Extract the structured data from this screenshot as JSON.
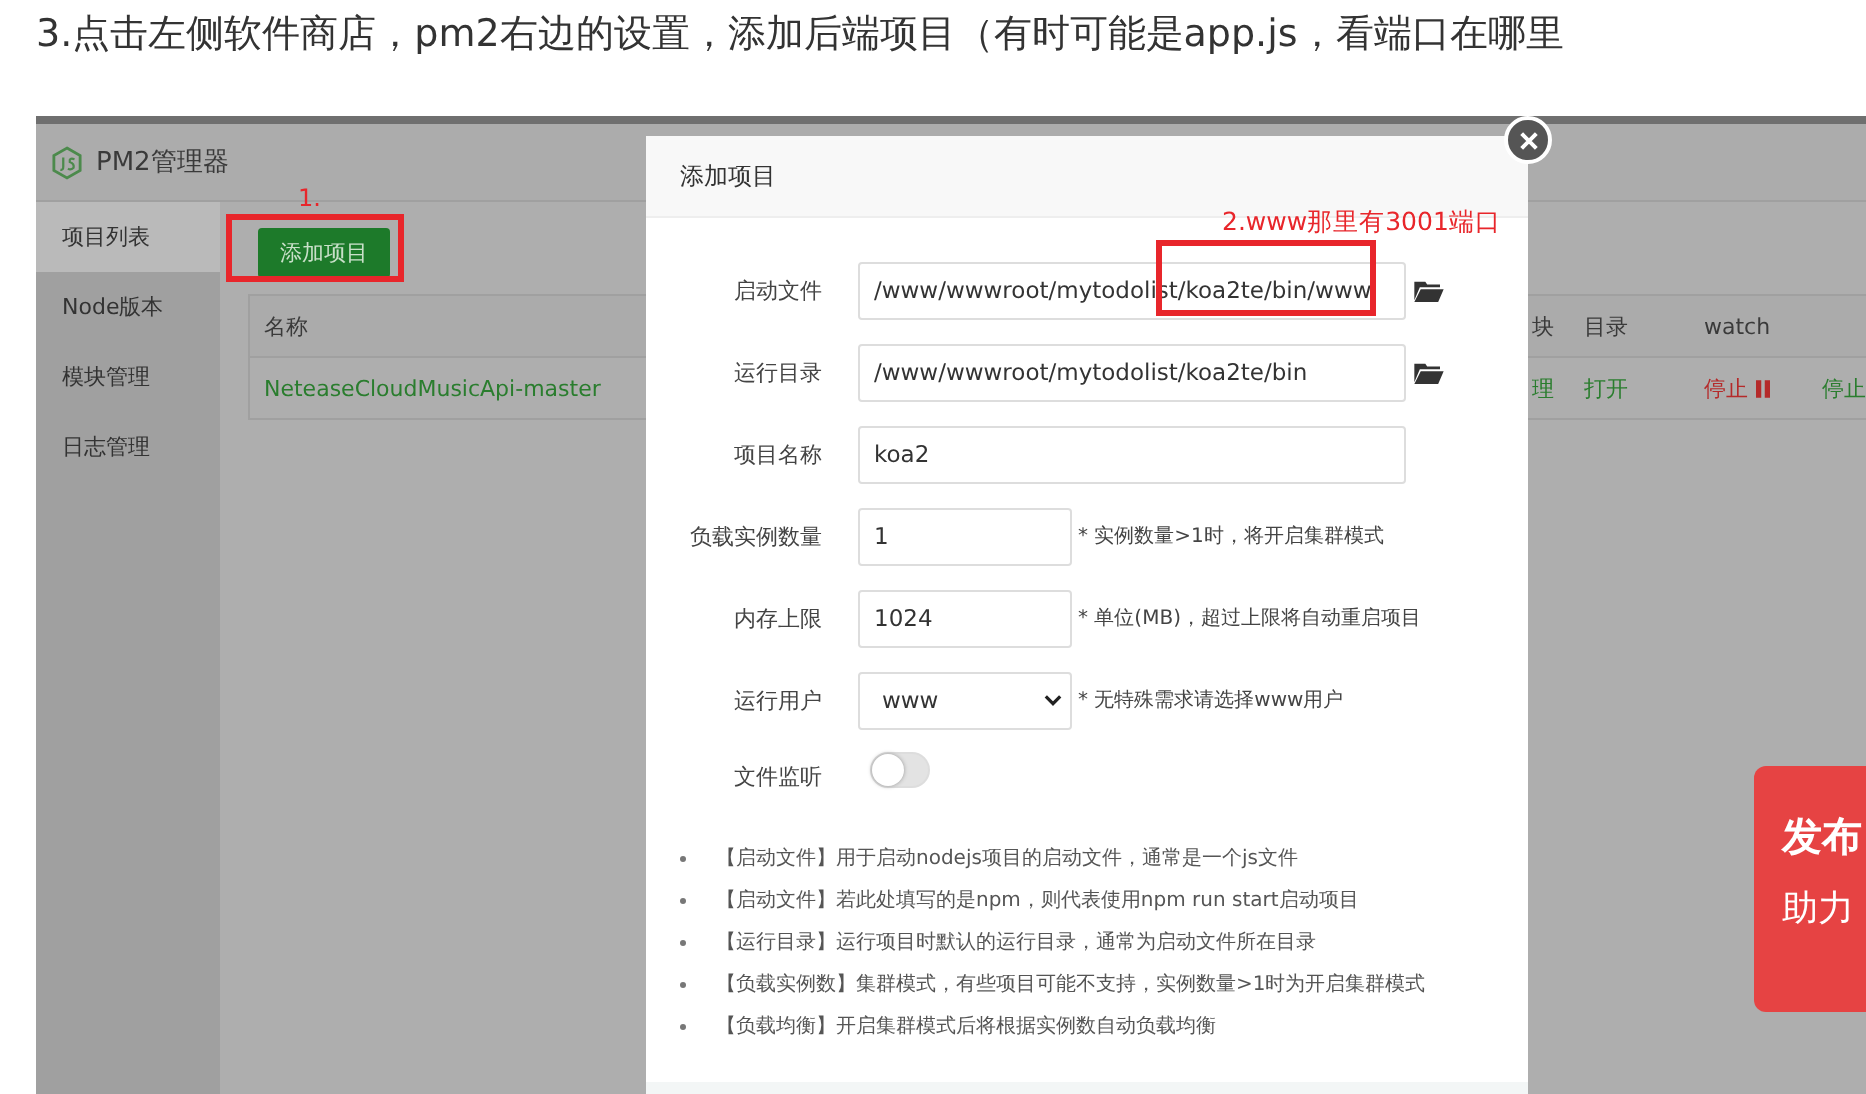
{
  "heading": "3.点击左侧软件商店，pm2右边的设置，添加后端项目（有时可能是app.js，看端口在哪里",
  "app": {
    "title": "PM2管理器",
    "sidebar": [
      {
        "label": "项目列表",
        "selected": true
      },
      {
        "label": "Node版本",
        "selected": false
      },
      {
        "label": "模块管理",
        "selected": false
      },
      {
        "label": "日志管理",
        "selected": false
      }
    ],
    "add_button": "添加项目",
    "table": {
      "columns": [
        "名称",
        "块",
        "目录",
        "watch"
      ],
      "rows": [
        {
          "cells": [
            {
              "text": "NeteaseCloudMusicApi-master",
              "color": "#2a7d2e",
              "kind": "text"
            },
            {
              "text": "理",
              "color": "#2a7d2e",
              "kind": "text"
            },
            {
              "text": "打开",
              "color": "#2a7d2e",
              "kind": "text"
            },
            {
              "text": "停止",
              "color": "#b52a2a",
              "kind": "pause"
            },
            {
              "text": "停止",
              "color": "#2a7d2e",
              "kind": "text"
            }
          ]
        }
      ]
    }
  },
  "annotations": [
    {
      "text": "1."
    },
    {
      "text": "2.www那里有3001端口"
    }
  ],
  "dialog": {
    "title": "添加项目",
    "fields": [
      {
        "kind": "path",
        "label": "启动文件",
        "value": "/www/wwwroot/mytodolist/koa2te/bin/www"
      },
      {
        "kind": "path",
        "label": "运行目录",
        "value": "/www/wwwroot/mytodolist/koa2te/bin"
      },
      {
        "kind": "text",
        "label": "项目名称",
        "value": "koa2"
      },
      {
        "kind": "number",
        "label": "负载实例数量",
        "value": "1",
        "hint": "* 实例数量>1时，将开启集群模式"
      },
      {
        "kind": "number",
        "label": "内存上限",
        "value": "1024",
        "hint": "* 单位(MB)，超过上限将自动重启项目"
      },
      {
        "kind": "select",
        "label": "运行用户",
        "value": "www",
        "hint": "* 无特殊需求请选择www用户"
      },
      {
        "kind": "toggle",
        "label": "文件监听",
        "on": false
      }
    ],
    "tips": [
      "【启动文件】用于启动nodejs项目的启动文件，通常是一个js文件",
      "【启动文件】若此处填写的是npm，则代表使用npm run start启动项目",
      "【运行目录】运行项目时默认的运行目录，通常为启动文件所在目录",
      "【负载实例数】集群模式，有些项目可能不支持，实例数量>1时为开启集群模式",
      "【负载均衡】开启集群模式后将根据实例数自动负载均衡"
    ]
  },
  "ad": {
    "lines": [
      "发布",
      "助力"
    ]
  }
}
